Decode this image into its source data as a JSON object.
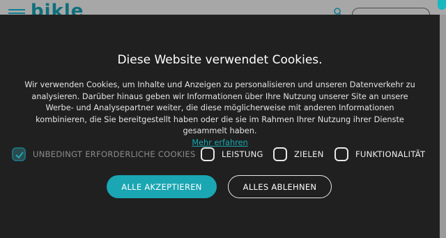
{
  "site": {
    "logo_text": "bikle",
    "icons": {
      "menu": "hamburger-icon",
      "search": "search-icon"
    }
  },
  "cookie_banner": {
    "title": "Diese Website verwendet Cookies.",
    "description": "Wir verwenden Cookies, um Inhalte und Anzeigen zu personalisieren und unseren Datenverkehr zu analysieren. Darüber hinaus geben wir Informationen über Ihre Nutzung unserer Site an unsere Werbe- und Analysepartner weiter, die diese möglicherweise mit anderen Informationen kombinieren, die Sie bereitgestellt haben oder die sie im Rahmen Ihrer Nutzung ihrer Dienste gesammelt haben.",
    "more_link": "Mehr erfahren",
    "options": [
      {
        "label": "UNBEDINGT ERFORDERLICHE COOKIES",
        "checked": true,
        "disabled": true
      },
      {
        "label": "LEISTUNG",
        "checked": false,
        "disabled": false
      },
      {
        "label": "ZIELEN",
        "checked": false,
        "disabled": false
      },
      {
        "label": "FUNKTIONALITÄT",
        "checked": false,
        "disabled": false
      }
    ],
    "accept_all": "ALLE AKZEPTIEREN",
    "reject_all": "ALLES ABLEHNEN"
  },
  "colors": {
    "accent": "#1aa6b3",
    "banner_bg": "#202020",
    "checked_box": "#2b4a4f"
  }
}
